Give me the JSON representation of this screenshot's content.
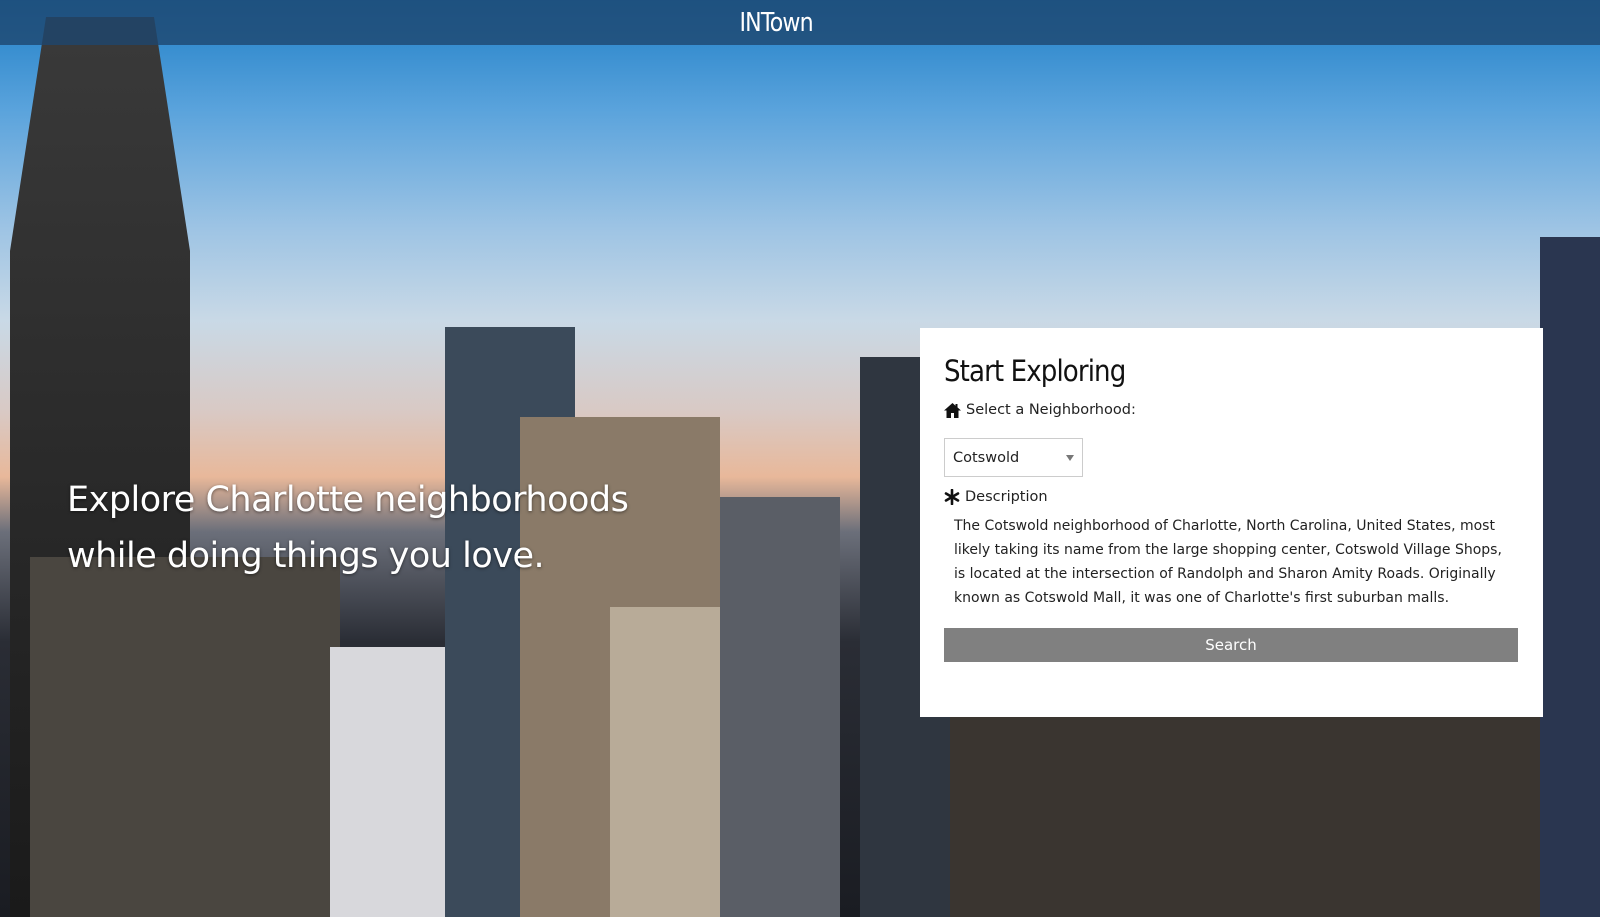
{
  "navbar": {
    "brand": "INTown"
  },
  "hero": {
    "line1": "Explore Charlotte neighborhoods",
    "line2": "while doing things you love."
  },
  "panel": {
    "title": "Start Exploring",
    "select_label": "Select a  Neighborhood:",
    "select_icon": "home-icon",
    "selected_neighborhood": "Cotswold",
    "description_label": "Description",
    "description_icon": "asterisk-icon",
    "description": "The Cotswold neighborhood of Charlotte,  North Carolina, United States, most likely taking its name from the large shopping center, Cotswold Village Shops, is located at the intersection of  Randolph and Sharon Amity  Roads. Originally known as Cotswold  Mall, it was one of Charlotte's first suburban malls.",
    "search_label": "Search"
  },
  "colors": {
    "button": "#808080",
    "navbar": "#2a5578"
  }
}
